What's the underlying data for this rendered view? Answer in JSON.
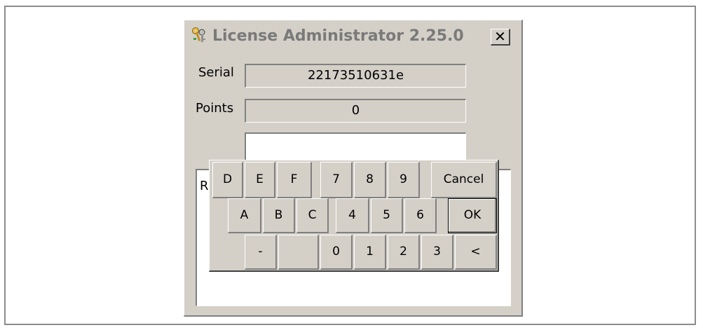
{
  "window": {
    "title": "License Administrator 2.25.0",
    "close_label": "✕"
  },
  "serial": {
    "label": "Serial",
    "value": "22173510631e"
  },
  "points": {
    "label": "Points",
    "value": "0"
  },
  "entry": {
    "value": ""
  },
  "memo": {
    "text": "R\n \n "
  },
  "keypad": {
    "row1": [
      "D",
      "E",
      "F",
      "7",
      "8",
      "9",
      "Cancel"
    ],
    "row2": [
      "A",
      "B",
      "C",
      "4",
      "5",
      "6",
      "OK"
    ],
    "row3": [
      "-",
      "",
      "0",
      "1",
      "2",
      "3",
      "<"
    ]
  },
  "colors": {
    "face": "#d4d0c8",
    "title_text": "#7a7a7a"
  },
  "icons": {
    "app": "keys-icon"
  }
}
